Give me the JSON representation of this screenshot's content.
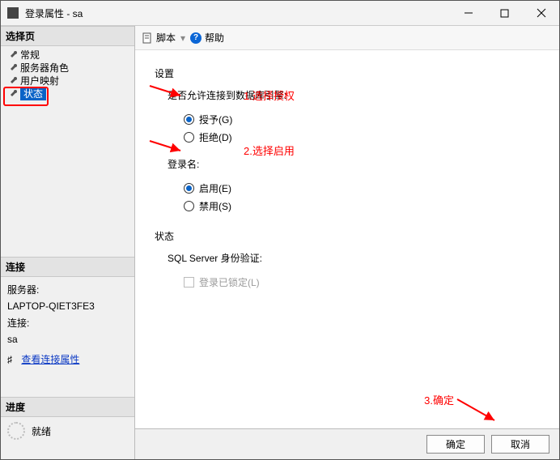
{
  "window": {
    "title": "登录属性 - sa"
  },
  "sidebar": {
    "select_pages": "选择页",
    "items": [
      {
        "label": "常规"
      },
      {
        "label": "服务器角色"
      },
      {
        "label": "用户映射"
      },
      {
        "label": "状态"
      }
    ],
    "connection_h": "连接",
    "server_label": "服务器:",
    "server_value": "LAPTOP-QIET3FE3",
    "conn_label": "连接:",
    "conn_value": "sa",
    "view_conn_props": "查看连接属性",
    "progress_h": "进度",
    "progress_status": "就绪"
  },
  "toolbar": {
    "script": "脚本",
    "help": "帮助"
  },
  "content": {
    "settings": "设置",
    "perm_q": "是否允许连接到数据库引擎:",
    "grant": "授予(G)",
    "deny": "拒绝(D)",
    "login_h": "登录名:",
    "enable": "启用(E)",
    "disable": "禁用(S)",
    "status_h": "状态",
    "sql_auth": "SQL Server 身份验证:",
    "locked": "登录已锁定(L)"
  },
  "annotations": {
    "a1": "1.选择授权",
    "a2": "2.选择启用",
    "a3": "3.确定"
  },
  "footer": {
    "ok": "确定",
    "cancel": "取消"
  }
}
